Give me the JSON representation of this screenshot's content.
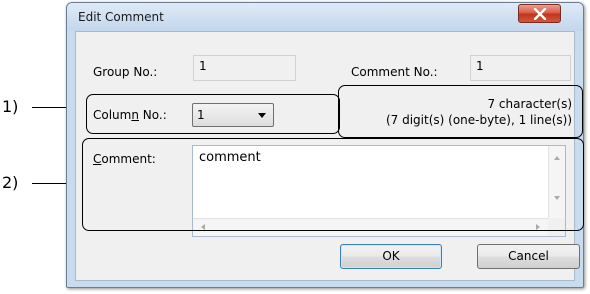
{
  "callouts": [
    {
      "label": "1)"
    },
    {
      "label": "2)"
    }
  ],
  "dialog": {
    "title": "Edit Comment",
    "close_label": "X",
    "group_no": {
      "label": "Group No.:",
      "value": "1"
    },
    "comment_no": {
      "label": "Comment No.:",
      "value": "1"
    },
    "column_no": {
      "label_pre": "Colum",
      "label_mnemonic": "n",
      "label_post": " No.:",
      "value": "1"
    },
    "info": {
      "line1": "7 character(s)",
      "line2": "(7 digit(s) (one-byte), 1 line(s))"
    },
    "comment": {
      "label_mnemonic": "C",
      "label_rest": "omment:",
      "value": "comment"
    },
    "buttons": {
      "ok": "OK",
      "cancel": "Cancel"
    }
  },
  "colors": {
    "frame": "#c9dbef",
    "client": "#f0f0f0",
    "close": "#c2331b"
  }
}
